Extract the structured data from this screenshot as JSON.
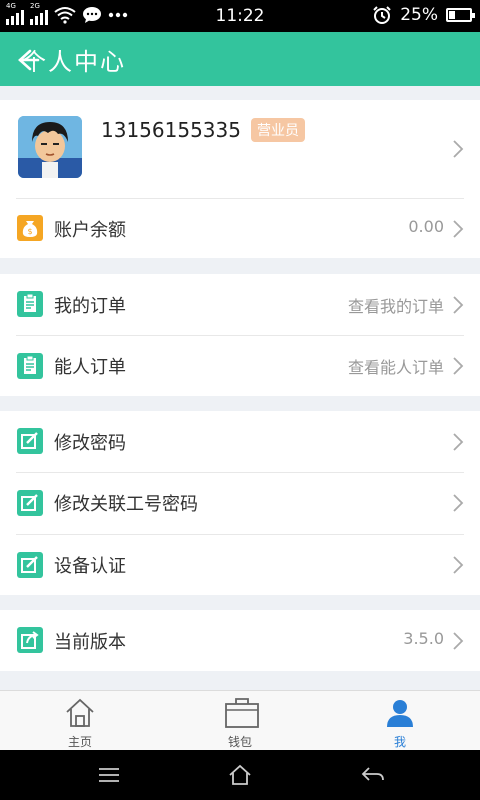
{
  "status_bar": {
    "time": "11:22",
    "battery": "25%",
    "battery_level": 0.25,
    "network_1": "4G",
    "network_2": "2G",
    "icons": [
      "signal-icon",
      "wifi-icon",
      "message-icon",
      "more-icon",
      "alarm-icon",
      "battery-icon"
    ]
  },
  "header": {
    "title": "个人中心"
  },
  "profile": {
    "phone": "13156155335",
    "role_badge": "营业员"
  },
  "balance": {
    "label": "账户余额",
    "value": "0.00"
  },
  "orders": [
    {
      "label": "我的订单",
      "hint": "查看我的订单"
    },
    {
      "label": "能人订单",
      "hint": "查看能人订单"
    }
  ],
  "settings": [
    {
      "label": "修改密码"
    },
    {
      "label": "修改关联工号密码"
    },
    {
      "label": "设备认证"
    }
  ],
  "version": {
    "label": "当前版本",
    "value": "3.5.0"
  },
  "tabs": [
    {
      "label": "主页",
      "icon": "home-icon",
      "active": false
    },
    {
      "label": "钱包",
      "icon": "wallet-icon",
      "active": false
    },
    {
      "label": "我",
      "icon": "person-icon",
      "active": true
    }
  ],
  "colors": {
    "accent": "#33c49d",
    "active_tab": "#2a7fd6",
    "badge": "#f6c7a3",
    "wallet_icon": "#f5a623"
  }
}
